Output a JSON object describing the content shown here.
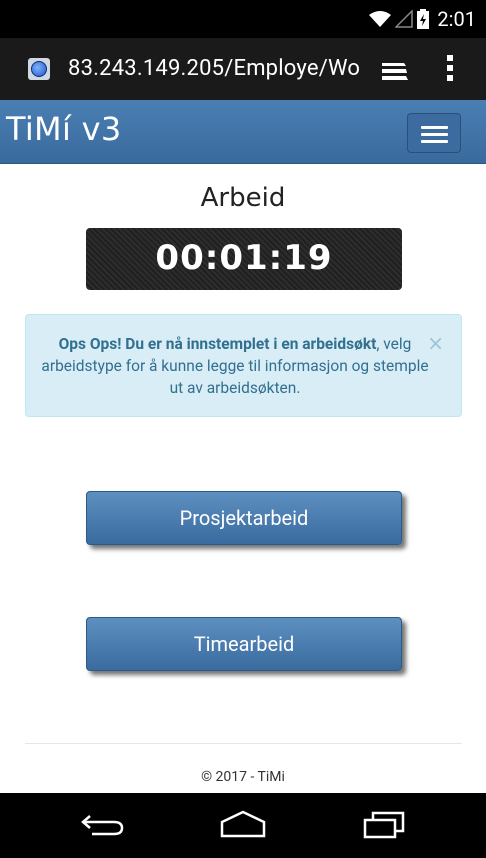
{
  "status_bar": {
    "time": "2:01"
  },
  "browser": {
    "url": "83.243.149.205/Employe/Wo"
  },
  "navbar": {
    "brand": "TiMí v3"
  },
  "page": {
    "title": "Arbeid",
    "timer": "00:01:19",
    "alert": {
      "strong": "Ops Ops! Du er nå innstemplet i en arbeidsøkt",
      "rest": ", velg arbeidstype for å kunne legge til informasjon og stemple ut av arbeidsøkten.",
      "close": "×"
    },
    "buttons": {
      "prosjekt": "Prosjektarbeid",
      "time": "Timearbeid"
    },
    "footer": "© 2017 - TiMi"
  },
  "colors": {
    "navbar": "#3e6fa3",
    "alert_bg": "#d9edf7",
    "alert_text": "#31708f",
    "button": "#4a7cb0"
  }
}
